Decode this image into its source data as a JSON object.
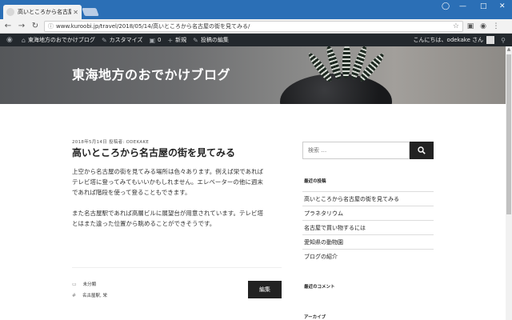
{
  "browser": {
    "tab_title": "高いところから名古屋の街を",
    "url": "www.kuroobi.jp/travel/2018/05/14/高いところから名古屋の街を見てみる/"
  },
  "adminbar": {
    "site_name": "東海地方のおでかけブログ",
    "customize": "カスタマイズ",
    "comments_count": "0",
    "new": "新規",
    "edit_post": "投稿の編集",
    "greeting": "こんにちは、odekake さん"
  },
  "header": {
    "site_title": "東海地方のおでかけブログ"
  },
  "post": {
    "meta": "2018年5月14日 投稿者: ODEKAKE",
    "title": "高いところから名古屋の街を見てみる",
    "paragraph1_line1": "上空から名古屋の街を見てみる場所は色々あります。例えば栄であれば",
    "paragraph1_line2": "テレビ塔に登ってみてもいいかもしれません。エレベーターの他に週末",
    "paragraph1_line3": "であれば階段を使って登ることもできます。",
    "paragraph2_line1": "また名古屋駅であれば高層ビルに展望台が用意されています。テレビ塔",
    "paragraph2_line2": "とはまた違った位置から眺めることができそうです。",
    "category": "未分類",
    "tags": "名古屋駅, 栄",
    "edit_label": "編集"
  },
  "sidebar": {
    "search_placeholder": "検索 …",
    "recent_title": "最近の投稿",
    "recent_posts": [
      "高いところから名古屋の街を見てみる",
      "プラネタリウム",
      "名古屋で買い物するには",
      "愛知県の動物園",
      "ブログの紹介"
    ],
    "comments_title": "最近のコメント",
    "archive_title": "アーカイブ"
  },
  "colors": {
    "browser_blue": "#2b6fb6",
    "adminbar": "#23282d",
    "button_dark": "#222222"
  }
}
